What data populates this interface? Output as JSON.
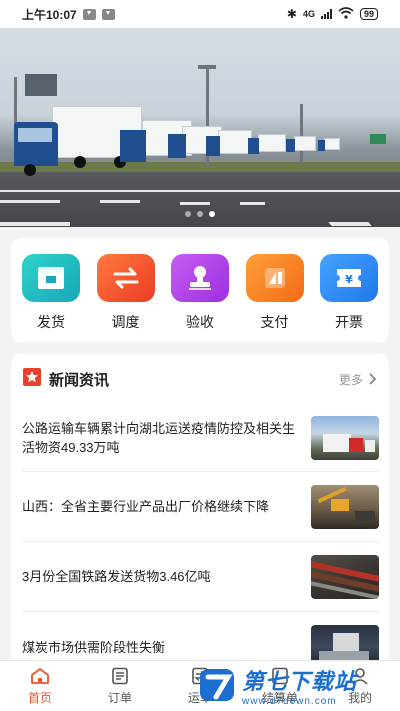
{
  "status_bar": {
    "time": "上午10:07",
    "network": "4G",
    "battery": "99"
  },
  "banner": {
    "slide_count": 3,
    "active_slide": 3
  },
  "actions": [
    {
      "label": "发货",
      "icon": "box-ship-icon",
      "color": "#1fbfbe"
    },
    {
      "label": "调度",
      "icon": "swap-arrows-icon",
      "color": "#f2532c"
    },
    {
      "label": "验收",
      "icon": "stamp-icon",
      "color": "#b23fe6"
    },
    {
      "label": "支付",
      "icon": "payment-card-icon",
      "color": "#f77b1d"
    },
    {
      "label": "开票",
      "icon": "invoice-ticket-icon",
      "color": "#2a8bf2"
    }
  ],
  "news": {
    "title": "新闻资讯",
    "more": "更多",
    "items": [
      {
        "text": "公路运输车辆累计向湖北运送疫情防控及相关生活物资49.33万吨",
        "thumb": "trucks-photo"
      },
      {
        "text": "山西：全省主要行业产品出厂价格继续下降",
        "thumb": "excavator-photo"
      },
      {
        "text": "3月份全国铁路发送货物3.46亿吨",
        "thumb": "railway-photo"
      },
      {
        "text": "煤炭市场供需阶段性失衡",
        "thumb": "coal-photo"
      }
    ]
  },
  "tabbar": {
    "items": [
      {
        "label": "首页",
        "active": true
      },
      {
        "label": "订单",
        "active": false
      },
      {
        "label": "运单",
        "active": false
      },
      {
        "label": "结算单",
        "active": false
      },
      {
        "label": "我的",
        "active": false
      }
    ]
  },
  "watermark": {
    "name": "第七下载站",
    "url": "www.d7down.com"
  }
}
